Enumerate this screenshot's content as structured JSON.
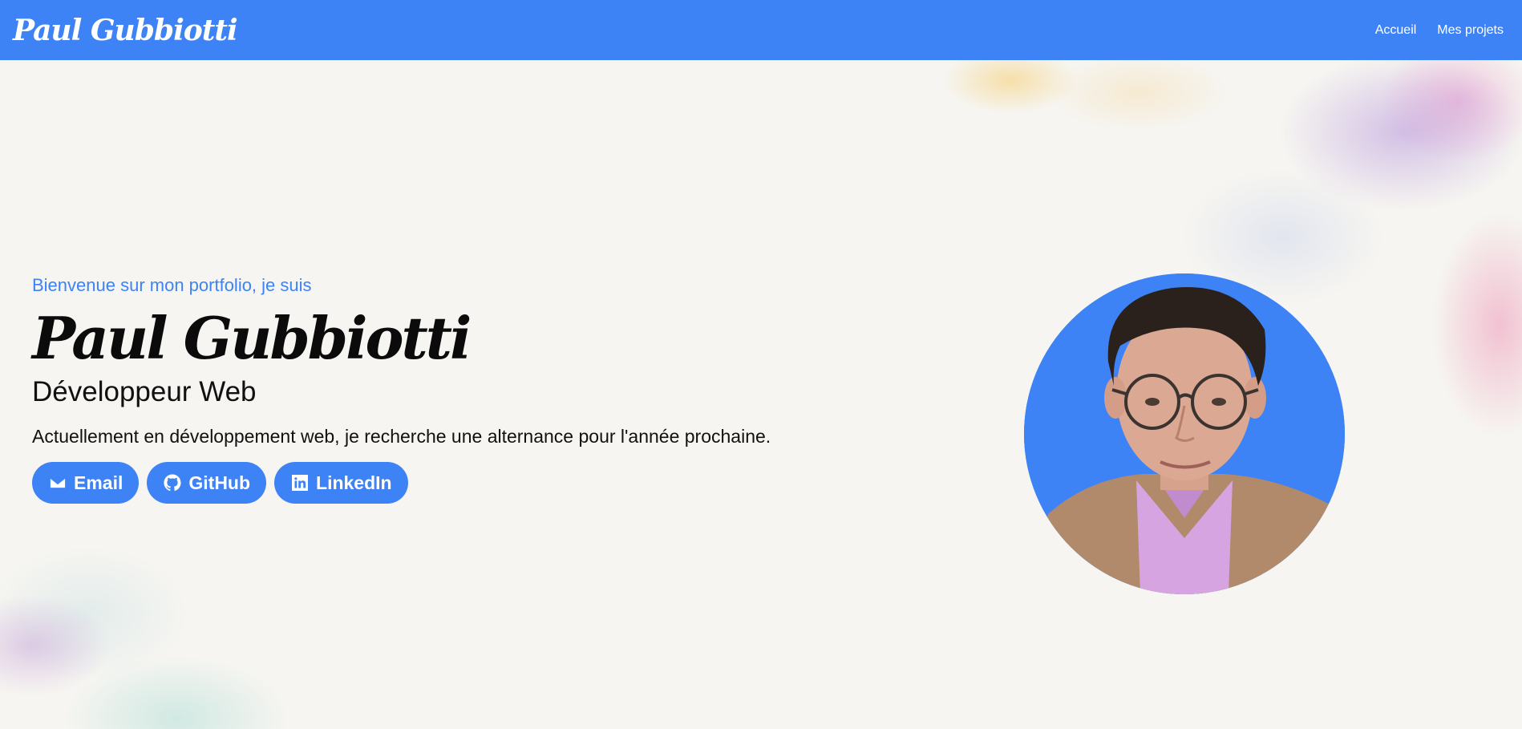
{
  "navbar": {
    "brand": "Paul Gubbiotti",
    "links": [
      "Accueil",
      "Mes projets"
    ]
  },
  "hero": {
    "greeting": "Bienvenue sur mon portfolio, je suis",
    "name": "Paul Gubbiotti",
    "role": "Développeur Web",
    "description": "Actuellement en développement web, je recherche une alternance pour l'année prochaine.",
    "buttons": [
      {
        "label": "Email",
        "icon": "envelope-icon"
      },
      {
        "label": "GitHub",
        "icon": "github-icon"
      },
      {
        "label": "LinkedIn",
        "icon": "linkedin-icon"
      }
    ]
  },
  "colors": {
    "accent": "#3d83f6",
    "background": "#f6f5f1",
    "text": "#0b0b0b"
  }
}
